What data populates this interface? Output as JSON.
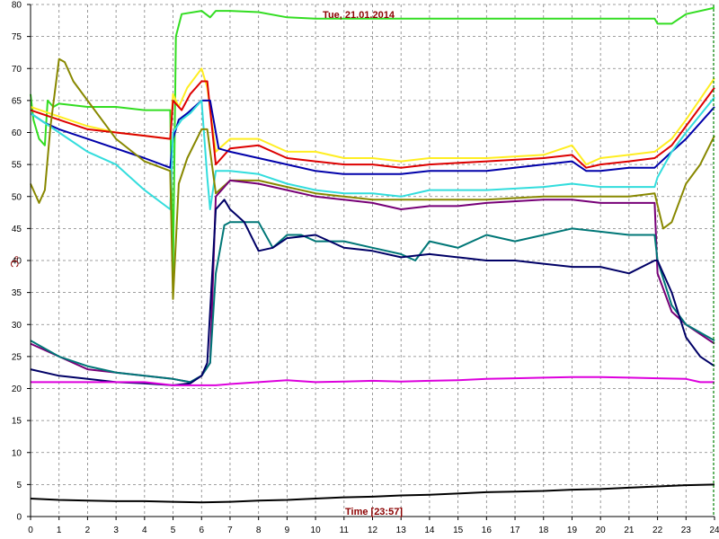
{
  "chart_data": {
    "type": "line",
    "title": "Tue, 21.01.2014",
    "xlabel": "Time [23:57]",
    "ylabel": "°C",
    "xlim": [
      0,
      24
    ],
    "ylim": [
      0,
      80
    ],
    "x_ticks": [
      0,
      1,
      2,
      3,
      4,
      5,
      6,
      7,
      8,
      9,
      10,
      11,
      12,
      13,
      14,
      15,
      16,
      17,
      18,
      19,
      20,
      21,
      22,
      23,
      24
    ],
    "y_ticks": [
      0,
      5,
      10,
      15,
      20,
      25,
      30,
      35,
      40,
      45,
      50,
      55,
      60,
      65,
      70,
      75,
      80
    ],
    "grid": true,
    "grid_style": "dashed",
    "colors": {
      "grid": "#808080",
      "axis": "#000000",
      "title": "#8b0000",
      "marker_line": "#008000"
    },
    "series": [
      {
        "color": "#33dd22",
        "x": [
          0,
          0.1,
          0.3,
          0.5,
          0.6,
          0.8,
          1,
          2,
          3,
          4,
          4.9,
          5,
          5.1,
          5.3,
          6,
          6.3,
          6.5,
          7,
          8,
          9,
          10,
          12,
          14,
          16,
          18,
          19,
          20,
          21,
          21.9,
          22,
          22.5,
          23,
          24
        ],
        "values": [
          66,
          62,
          59,
          58,
          65,
          64,
          64.5,
          64,
          64,
          63.5,
          63.5,
          38,
          75,
          78.5,
          79,
          78,
          79,
          79,
          78.8,
          78,
          77.8,
          77.8,
          77.8,
          77.8,
          77.8,
          77.8,
          77.8,
          77.8,
          77.8,
          77,
          77,
          78.5,
          79.5
        ]
      },
      {
        "color": "#ffee22",
        "x": [
          0,
          1,
          2,
          3,
          4,
          4.9,
          5,
          5.2,
          5.5,
          6,
          6.2,
          6.5,
          7,
          8,
          9,
          10,
          11,
          12,
          13,
          14,
          16,
          18,
          19,
          19.5,
          20,
          21,
          21.9,
          22.5,
          23,
          24
        ],
        "values": [
          64,
          62.5,
          61,
          60,
          59.5,
          59,
          66,
          64,
          67,
          70,
          67,
          57,
          59,
          59,
          57,
          57,
          56,
          56,
          55.5,
          56,
          56,
          56.5,
          58,
          55,
          56,
          56.5,
          57,
          59,
          62,
          68.5
        ]
      },
      {
        "color": "#dd0000",
        "x": [
          0,
          1,
          2,
          3,
          4,
          4.9,
          5,
          5.3,
          5.6,
          6,
          6.2,
          6.5,
          7,
          8,
          9,
          10,
          11,
          12,
          13,
          14,
          16,
          18,
          19,
          19.5,
          20,
          21,
          21.9,
          22.5,
          23,
          24
        ],
        "values": [
          63.5,
          62,
          60.5,
          60,
          59.5,
          59,
          65,
          63.5,
          66,
          68,
          68,
          55,
          57.5,
          58,
          56,
          55.5,
          55,
          55,
          54.5,
          55,
          55.5,
          56,
          56.5,
          54.5,
          55,
          55.5,
          56,
          58,
          61,
          67
        ]
      },
      {
        "color": "#0000aa",
        "x": [
          0,
          0.5,
          1,
          2,
          3,
          4,
          4.9,
          5,
          5.2,
          5.5,
          6,
          6.3,
          6.6,
          7,
          8,
          9,
          10,
          11,
          12,
          13,
          14,
          16,
          18,
          19,
          19.5,
          20,
          21,
          21.9,
          22.5,
          23,
          24
        ],
        "values": [
          63,
          61.5,
          60.5,
          59,
          57.5,
          56,
          54.5,
          59,
          62,
          63,
          65,
          65,
          57.5,
          57,
          56,
          55,
          54,
          53.5,
          53.5,
          53.5,
          54,
          54,
          55,
          55.5,
          54,
          54,
          54.5,
          54.5,
          57,
          59,
          64
        ]
      },
      {
        "color": "#33dddd",
        "x": [
          0,
          1,
          2,
          3,
          4,
          4.9,
          5,
          5.3,
          5.6,
          6,
          6.2,
          6.3,
          6.5,
          7,
          8,
          9,
          10,
          11,
          12,
          13,
          14,
          16,
          18,
          19,
          20,
          21,
          21.9,
          22,
          22.5,
          23,
          24
        ],
        "values": [
          63,
          60,
          57,
          55,
          51,
          48,
          60,
          62,
          63,
          65,
          53,
          48,
          54,
          54,
          53.5,
          52,
          51,
          50.5,
          50.5,
          50,
          51,
          51,
          51.5,
          52,
          51.5,
          51.5,
          51.5,
          53,
          57,
          60,
          65.5
        ]
      },
      {
        "color": "#888800",
        "x": [
          0,
          0.3,
          0.5,
          0.7,
          1,
          1.2,
          1.5,
          2,
          3,
          4,
          4.9,
          5,
          5.2,
          5.5,
          6,
          6.2,
          6.5,
          7,
          8,
          9,
          10,
          11,
          12,
          13,
          14,
          16,
          18,
          20,
          21,
          21.9,
          22.2,
          22.5,
          23,
          23.5,
          24
        ],
        "values": [
          52,
          49,
          51,
          61,
          71.5,
          71,
          68,
          65,
          59,
          55.5,
          54,
          34,
          52,
          56,
          60.5,
          60.5,
          50.5,
          52.5,
          52.5,
          51.5,
          50.5,
          50,
          49.5,
          49.5,
          49.5,
          49.5,
          50,
          50,
          50,
          50.5,
          45,
          46,
          52,
          55,
          59.5
        ]
      },
      {
        "color": "#770077",
        "x": [
          0,
          1,
          2,
          3,
          4,
          5,
          5.6,
          6,
          6.3,
          6.5,
          7,
          8,
          9,
          10,
          11,
          12,
          13,
          14,
          15,
          16,
          18,
          19,
          20,
          21,
          21.9,
          22,
          22.5,
          23,
          24
        ],
        "values": [
          27,
          25,
          23,
          22.5,
          22,
          21.5,
          21,
          22,
          24,
          50,
          52.5,
          52,
          51,
          50,
          49.5,
          49,
          48,
          48.5,
          48.5,
          49,
          49.5,
          49.5,
          49,
          49,
          49,
          38,
          32,
          30,
          27
        ]
      },
      {
        "color": "#007777",
        "x": [
          0,
          1,
          2,
          3,
          4,
          5,
          5.6,
          6,
          6.3,
          6.5,
          6.8,
          7,
          8,
          8.5,
          9,
          9.5,
          10,
          11,
          12,
          13,
          13.5,
          14,
          15,
          16,
          17,
          18,
          19,
          20,
          21,
          21.9,
          22,
          22.5,
          23,
          24
        ],
        "values": [
          27.5,
          25,
          23.5,
          22.5,
          22,
          21.5,
          21,
          22,
          24,
          38,
          45.5,
          46,
          46,
          42,
          44,
          44,
          43,
          43,
          42,
          41,
          40,
          43,
          42,
          44,
          43,
          44,
          45,
          44.5,
          44,
          44,
          40,
          33,
          30,
          27.5
        ]
      },
      {
        "color": "#000066",
        "x": [
          0,
          1,
          2,
          3,
          4,
          5,
          5.6,
          6,
          6.2,
          6.5,
          6.8,
          7,
          7.5,
          8,
          8.5,
          9,
          10,
          11,
          12,
          13,
          14,
          15,
          16,
          17,
          18,
          19,
          20,
          21,
          21.9,
          22,
          22.5,
          23,
          23.5,
          24
        ],
        "values": [
          23,
          22,
          21.5,
          21,
          20.8,
          20.5,
          20.8,
          22,
          24,
          48,
          49.5,
          48,
          46,
          41.5,
          42,
          43.5,
          44,
          42,
          41.5,
          40.5,
          41,
          40.5,
          40,
          40,
          39.5,
          39,
          39,
          38,
          40,
          40,
          35,
          28,
          25,
          23.5
        ]
      },
      {
        "color": "#dd00dd",
        "x": [
          0,
          1,
          2,
          3,
          4,
          5,
          6,
          6.5,
          7,
          8,
          9,
          10,
          11,
          12,
          13,
          14,
          15,
          16,
          17,
          18,
          19,
          20,
          21,
          22,
          23,
          23.5,
          24
        ],
        "values": [
          21,
          21,
          21,
          21,
          21,
          20.5,
          20.5,
          20.5,
          20.7,
          21,
          21.3,
          21,
          21.1,
          21.2,
          21.1,
          21.2,
          21.3,
          21.5,
          21.6,
          21.7,
          21.8,
          21.8,
          21.7,
          21.6,
          21.5,
          21,
          21
        ]
      },
      {
        "color": "#000000",
        "x": [
          0,
          1,
          2,
          3,
          4,
          5,
          6,
          7,
          8,
          9,
          10,
          11,
          12,
          13,
          14,
          15,
          16,
          17,
          18,
          19,
          20,
          21,
          22,
          23,
          24
        ],
        "values": [
          2.8,
          2.6,
          2.5,
          2.4,
          2.4,
          2.3,
          2.2,
          2.3,
          2.5,
          2.6,
          2.8,
          3,
          3.1,
          3.3,
          3.4,
          3.6,
          3.8,
          3.9,
          4,
          4.2,
          4.3,
          4.5,
          4.7,
          4.9,
          5
        ]
      }
    ],
    "marker_x": 24
  }
}
